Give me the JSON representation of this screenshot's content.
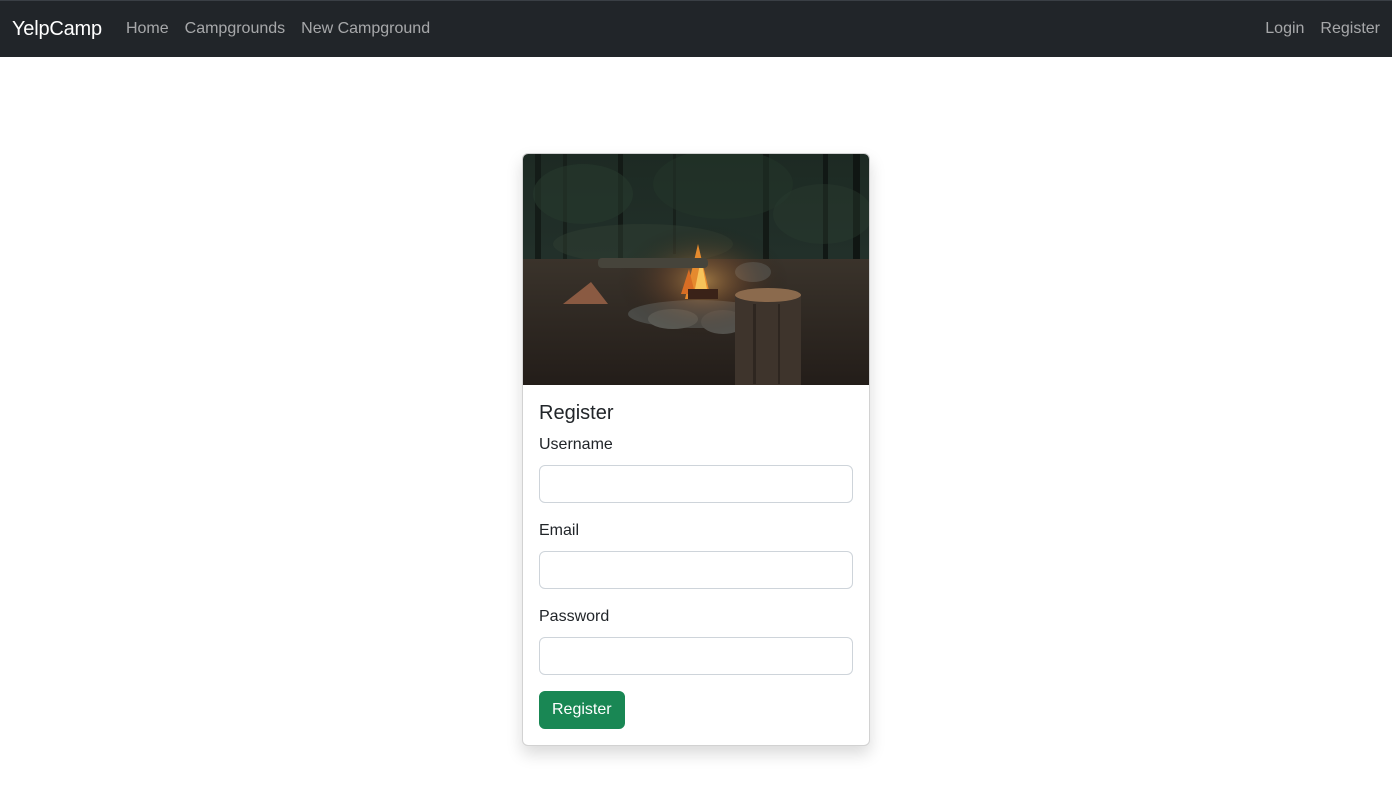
{
  "navbar": {
    "brand": "YelpCamp",
    "links": [
      {
        "label": "Home"
      },
      {
        "label": "Campgrounds"
      },
      {
        "label": "New Campground"
      }
    ],
    "right_links": [
      {
        "label": "Login"
      },
      {
        "label": "Register"
      }
    ],
    "background": "#212529"
  },
  "card": {
    "image": "campfire-forest-photo",
    "title": "Register",
    "fields": [
      {
        "label": "Username",
        "value": "",
        "placeholder": ""
      },
      {
        "label": "Email",
        "value": "",
        "placeholder": ""
      },
      {
        "label": "Password",
        "value": "",
        "placeholder": ""
      }
    ],
    "submit_label": "Register",
    "submit_color": "#198754"
  }
}
